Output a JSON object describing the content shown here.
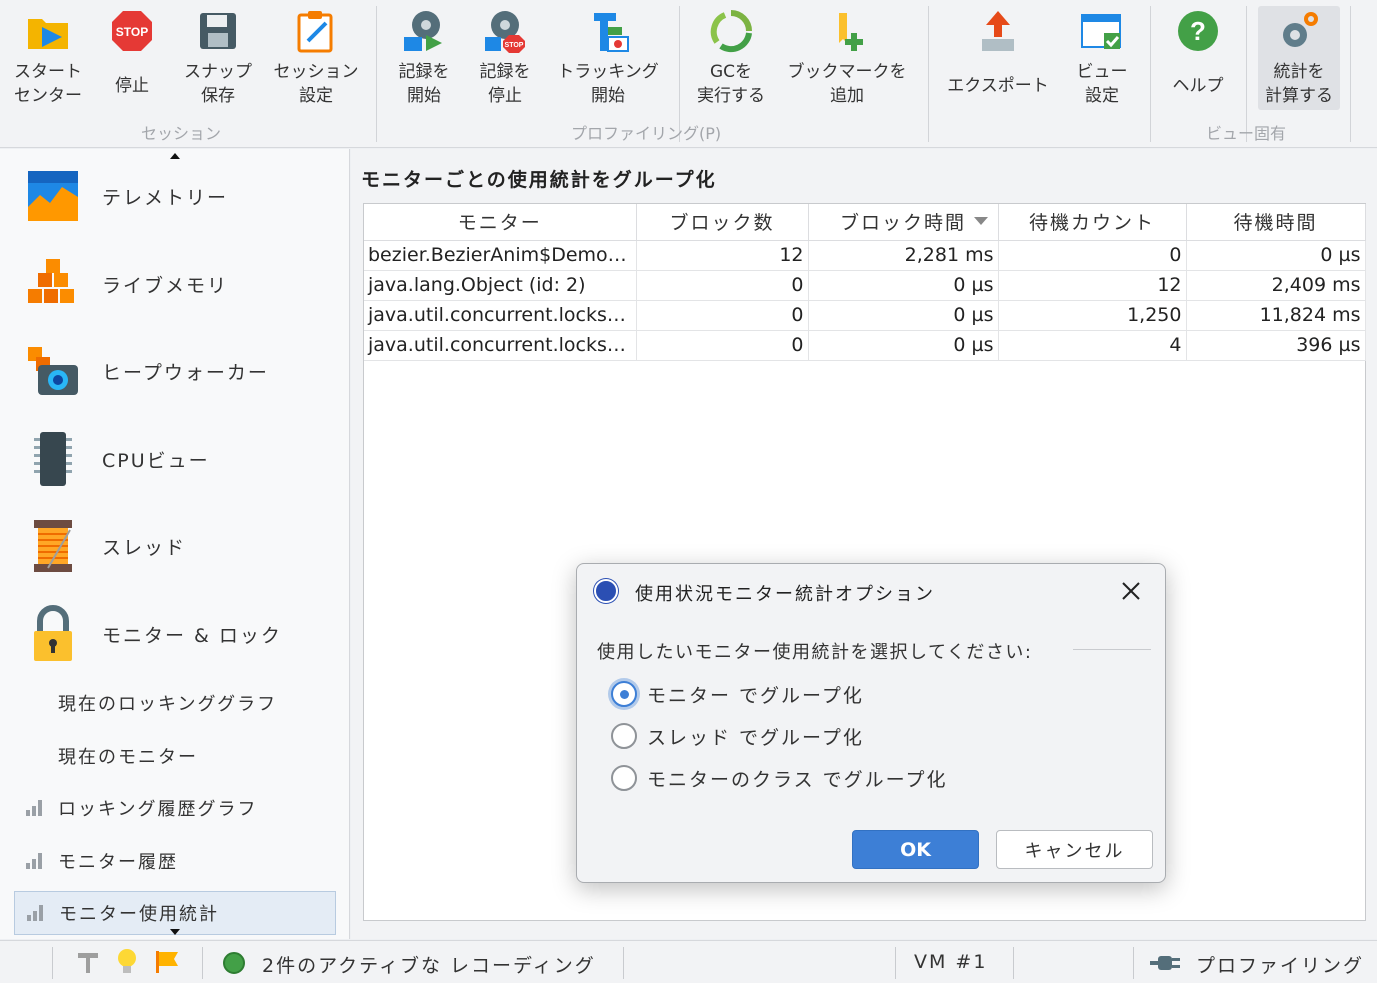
{
  "toolbar": {
    "groups": [
      {
        "label": "セッション"
      },
      {
        "label": "プロファイリング(P)"
      },
      {
        "label": "ビュー固有"
      }
    ],
    "buttons": [
      {
        "line1": "スタート",
        "line2": "センター",
        "icon": "start-center-icon"
      },
      {
        "line1": "停止",
        "icon": "stop-icon",
        "icon_text": "STOP"
      },
      {
        "line1": "スナップ",
        "line2": "保存",
        "icon": "save-snapshot-icon"
      },
      {
        "line1": "セッション",
        "line2": "設定",
        "icon": "session-settings-icon"
      },
      {
        "line1": "記録を",
        "line2": "開始",
        "icon": "start-recording-icon"
      },
      {
        "line1": "記録を",
        "line2": "停止",
        "icon": "stop-recording-icon",
        "icon_text": "STOP"
      },
      {
        "line1": "トラッキング",
        "line2": "開始",
        "icon": "start-tracking-icon"
      },
      {
        "line1": "GCを",
        "line2": "実行する",
        "icon": "run-gc-icon"
      },
      {
        "line1": "ブックマークを",
        "line2": "追加",
        "icon": "add-bookmark-icon"
      },
      {
        "line1": "エクスポート",
        "icon": "export-icon"
      },
      {
        "line1": "ビュー",
        "line2": "設定",
        "icon": "view-settings-icon"
      },
      {
        "line1": "ヘルプ",
        "icon": "help-icon",
        "icon_text": "?"
      },
      {
        "line1": "統計を",
        "line2": "計算する",
        "icon": "calculate-statistics-icon"
      }
    ]
  },
  "sidebar": {
    "items": [
      {
        "label": "テレメトリー",
        "icon": "telemetry-icon"
      },
      {
        "label": "ライブメモリ",
        "icon": "live-memory-icon"
      },
      {
        "label": "ヒープウォーカー",
        "icon": "heap-walker-icon"
      },
      {
        "label": "CPUビュー",
        "icon": "cpu-view-icon"
      },
      {
        "label": "スレッド",
        "icon": "threads-icon"
      },
      {
        "label": "モニター & ロック",
        "icon": "monitors-locks-icon"
      }
    ],
    "subitems": [
      {
        "label": "現在のロッキンググラフ"
      },
      {
        "label": "現在のモニター"
      },
      {
        "label": "ロッキング履歴グラフ"
      },
      {
        "label": "モニター履歴"
      },
      {
        "label": "モニター使用統計"
      }
    ]
  },
  "main": {
    "title": "モニターごとの使用統計をグループ化",
    "columns": [
      "モニター",
      "ブロック数",
      "ブロック時間",
      "待機カウント",
      "待機時間"
    ],
    "rows": [
      [
        "bezier.BezierAnim$Demo (i...",
        "12",
        "2,281 ms",
        "0",
        "0 µs"
      ],
      [
        "java.lang.Object (id: 2)",
        "0",
        "0 µs",
        "12",
        "2,409 ms"
      ],
      [
        "java.util.concurrent.locks.A...",
        "0",
        "0 µs",
        "1,250",
        "11,824 ms"
      ],
      [
        "java.util.concurrent.locks.R...",
        "0",
        "0 µs",
        "4",
        "396 µs"
      ]
    ]
  },
  "statusbar": {
    "recording": "2件のアクティブな レコーディング",
    "vm": "VM #1",
    "mode": "プロファイリング"
  },
  "dialog": {
    "title": "使用状況モニター統計オプション",
    "prompt": "使用したいモニター使用統計を選択してください:",
    "options": [
      {
        "label": "モニター でグループ化",
        "checked": true
      },
      {
        "label": "スレッド でグループ化",
        "checked": false
      },
      {
        "label": "モニターのクラス でグループ化",
        "checked": false
      }
    ],
    "ok_label": "OK",
    "cancel_label": "キャンセル"
  }
}
